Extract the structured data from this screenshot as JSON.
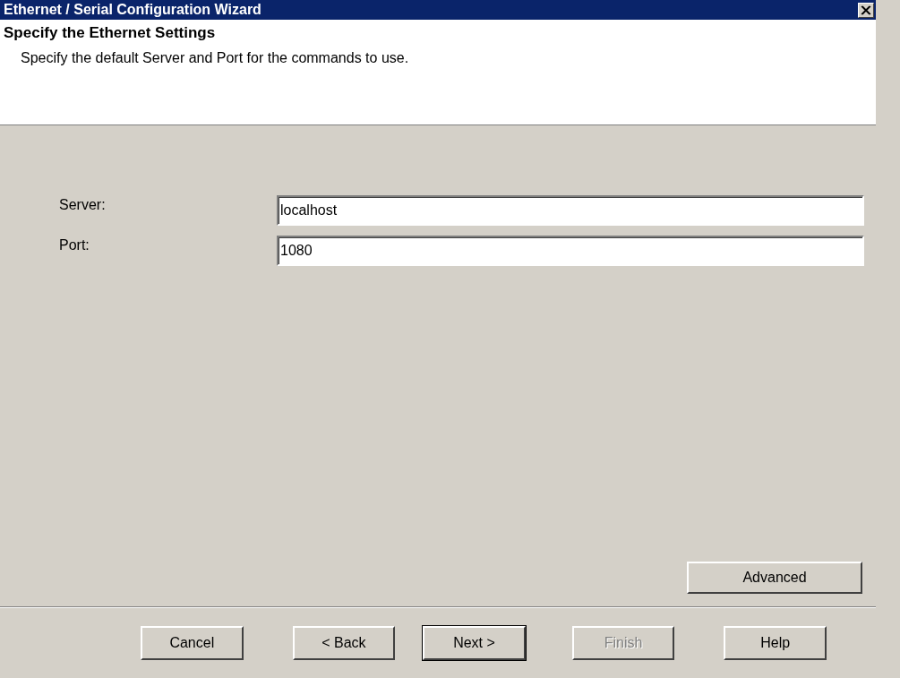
{
  "window": {
    "title": "Ethernet / Serial Configuration Wizard"
  },
  "header": {
    "title": "Specify the Ethernet Settings",
    "subtitle": "Specify the default Server and Port for the commands to use."
  },
  "fields": [
    {
      "label": "Server:",
      "value": "localhost"
    },
    {
      "label": "Port:",
      "value": "1080"
    }
  ],
  "advanced_button": {
    "label": "Advanced"
  },
  "buttons": [
    {
      "label": "Cancel",
      "disabled": false,
      "default": false
    },
    {
      "label": "< Back",
      "disabled": false,
      "default": false
    },
    {
      "label": "Next >",
      "disabled": false,
      "default": true
    },
    {
      "label": "Finish",
      "disabled": true,
      "default": false
    },
    {
      "label": "Help",
      "disabled": false,
      "default": false
    }
  ]
}
